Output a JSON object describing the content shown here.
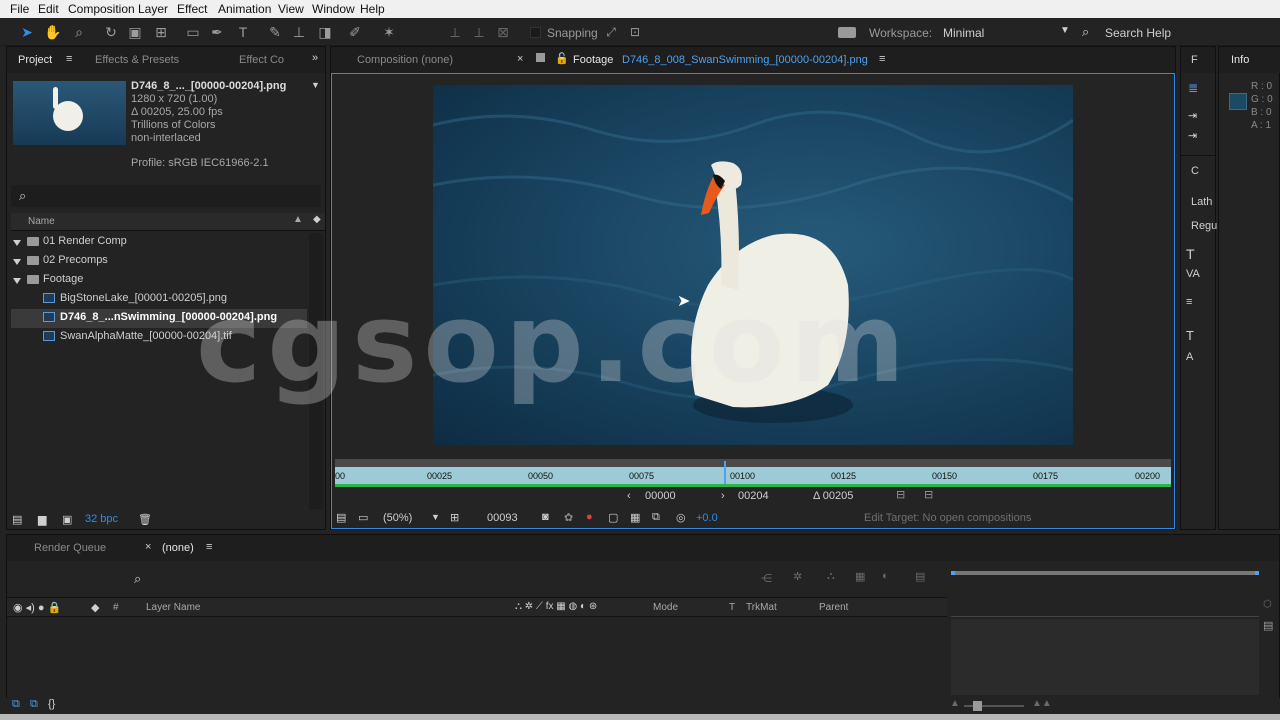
{
  "menu": [
    "File",
    "Edit",
    "Composition",
    "Layer",
    "Effect",
    "Animation",
    "View",
    "Window",
    "Help"
  ],
  "toolbar": {
    "snapping_label": "Snapping",
    "workspace_label": "Workspace:",
    "workspace_value": "Minimal",
    "search_help": "Search Help"
  },
  "project": {
    "tabs": [
      "Project",
      "Effects & Presets",
      "Effect Co"
    ],
    "file_name": "D746_8_..._[00000-00204].png",
    "info_lines": [
      "1280 x 720 (1.00)",
      "Δ 00205, 25.00 fps",
      "Trillions of Colors",
      "non-interlaced"
    ],
    "profile": "Profile: sRGB IEC61966-2.1",
    "name_header": "Name",
    "items": [
      {
        "label": "01 Render Comp",
        "type": "folder"
      },
      {
        "label": "02 Precomps",
        "type": "folder"
      },
      {
        "label": "Footage",
        "type": "folder"
      },
      {
        "label": "BigStoneLake_[00001-00205].png",
        "type": "file"
      },
      {
        "label": "D746_8_...nSwimming_[00000-00204].png",
        "type": "file"
      },
      {
        "label": "SwanAlphaMatte_[00000-00204].tif",
        "type": "file"
      }
    ],
    "bpc": "32 bpc"
  },
  "viewer": {
    "tab_comp": "Composition (none)",
    "tab_footage_prefix": "Footage",
    "tab_footage_name": "D746_8_008_SwanSwimming_[00000-00204].png",
    "ruler_ticks": [
      "00",
      "00025",
      "00050",
      "00075",
      "00100",
      "00125",
      "00150",
      "00175",
      "00200"
    ],
    "in_point": "00000",
    "out_point": "00204",
    "duration": "Δ 00205",
    "zoom": "(50%)",
    "timecode": "00093",
    "exposure": "+0.0",
    "edit_target": "Edit Target: No open compositions",
    "playhead_fraction": 0.465
  },
  "info": {
    "tab": "Info",
    "channels": [
      "R : 0",
      "G : 0",
      "B : 0",
      "A : 1"
    ],
    "side_labels": [
      "Lath",
      "Regu"
    ]
  },
  "timeline": {
    "tab_render": "Render Queue",
    "tab_none": "(none)",
    "col_hash": "#",
    "col_layer": "Layer Name",
    "col_mode": "Mode",
    "col_t": "T",
    "col_trkmat": "TrkMat",
    "col_parent": "Parent"
  },
  "watermark": "cgsop.com"
}
